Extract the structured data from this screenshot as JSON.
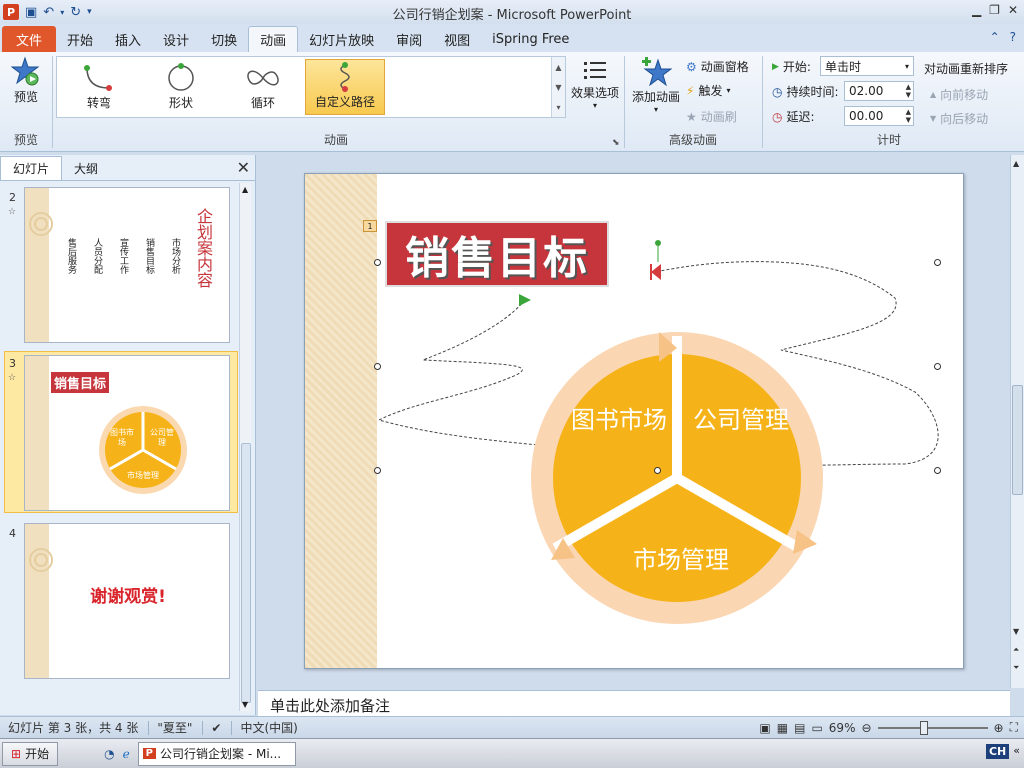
{
  "app": {
    "title": "公司行销企划案 - Microsoft PowerPoint",
    "logo": "P"
  },
  "tabs": {
    "file": "文件",
    "items": [
      "开始",
      "插入",
      "设计",
      "切换",
      "动画",
      "幻灯片放映",
      "审阅",
      "视图",
      "iSpring Free"
    ],
    "active_index": 4
  },
  "ribbon": {
    "preview": {
      "label": "预览",
      "group": "预览"
    },
    "animation_gallery": {
      "items": [
        "转弯",
        "形状",
        "循环",
        "自定义路径"
      ],
      "selected_index": 3,
      "group": "动画"
    },
    "effect_options": "效果选项",
    "advanced": {
      "add_animation": "添加动画",
      "animation_pane": "动画窗格",
      "trigger": "触发",
      "animation_painter": "动画刷",
      "group": "高级动画"
    },
    "timing": {
      "start_label": "开始:",
      "start_value": "单击时",
      "duration_label": "持续时间:",
      "duration_value": "02.00",
      "delay_label": "延迟:",
      "delay_value": "00.00",
      "reorder_title": "对动画重新排序",
      "move_earlier": "向前移动",
      "move_later": "向后移动",
      "group": "计时"
    }
  },
  "pane": {
    "tabs": [
      "幻灯片",
      "大纲"
    ],
    "slides": [
      {
        "num": "2",
        "title": "企划案内容",
        "bullets": [
          "售后服务",
          "人员分配",
          "宣传工作",
          "销售目标",
          "市场分析"
        ]
      },
      {
        "num": "3",
        "title": "销售目标",
        "segments": [
          "图书市场",
          "公司管理",
          "市场管理"
        ]
      },
      {
        "num": "4",
        "title": "谢谢观赏!"
      }
    ]
  },
  "slide": {
    "title": "销售目标",
    "anim_badge": "1",
    "segments": [
      "图书市场",
      "公司管理",
      "市场管理"
    ]
  },
  "notes": {
    "placeholder": "单击此处添加备注"
  },
  "status": {
    "slide_info": "幻灯片 第 3 张，共 4 张",
    "theme": "\"夏至\"",
    "language": "中文(中国)",
    "zoom": "69%"
  },
  "taskbar": {
    "start": "开始",
    "task": "公司行销企划案 - Mi...",
    "ime": "CH"
  },
  "colors": {
    "accent_orange": "#f4a81b",
    "title_red": "#c6353b",
    "file_tab": "#e0572b"
  }
}
